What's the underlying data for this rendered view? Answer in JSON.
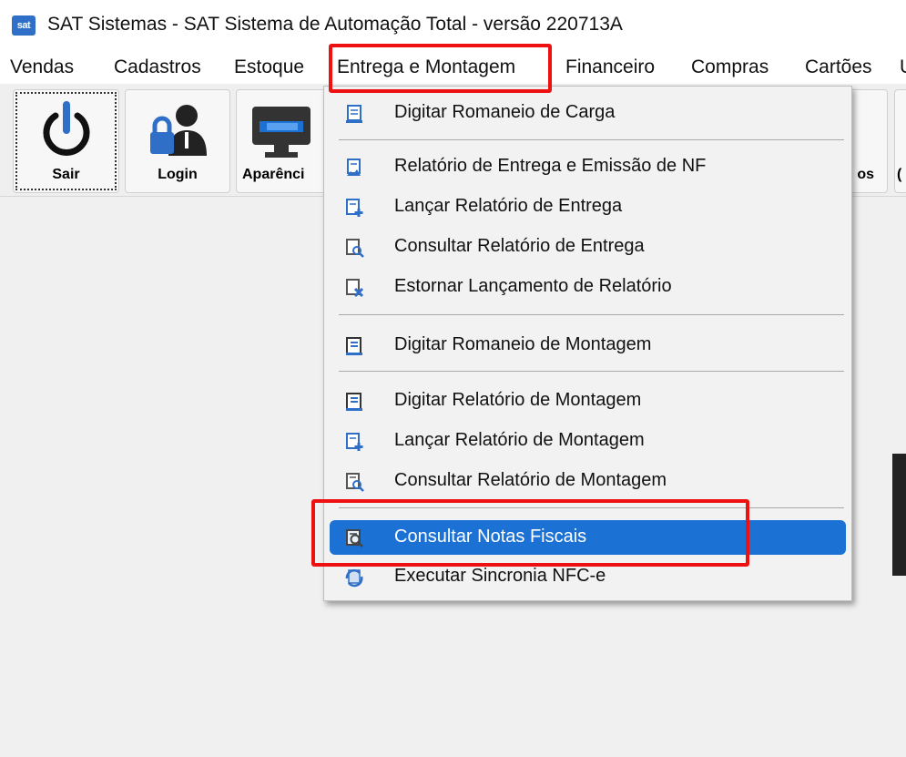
{
  "window": {
    "title": "SAT Sistemas - SAT Sistema de Automação Total - versão 220713A",
    "logo_text": "sat"
  },
  "menubar": {
    "items": [
      {
        "label": "Vendas"
      },
      {
        "label": "Cadastros"
      },
      {
        "label": "Estoque"
      },
      {
        "label": "Entrega e Montagem"
      },
      {
        "label": "Financeiro"
      },
      {
        "label": "Compras"
      },
      {
        "label": "Cartões"
      },
      {
        "label": "U"
      }
    ]
  },
  "toolbar": {
    "buttons": [
      {
        "label": "Sair",
        "icon": "power-icon"
      },
      {
        "label": "Login",
        "icon": "user-lock-icon"
      },
      {
        "label": "Aparênci",
        "icon": "monitor-icon"
      },
      {
        "label": "os",
        "icon": "document-icon"
      },
      {
        "label": "(",
        "icon": "partial-icon"
      }
    ]
  },
  "dropdown": {
    "items": [
      {
        "label": "Digitar Romaneio de Carga",
        "icon": "form-icon"
      },
      {
        "label": "Relatório de Entrega e Emissão de NF",
        "icon": "report-invoice-icon"
      },
      {
        "label": "Lançar Relatório de Entrega",
        "icon": "report-add-icon"
      },
      {
        "label": "Consultar Relatório de Entrega",
        "icon": "report-search-icon"
      },
      {
        "label": "Estornar Lançamento de Relatório",
        "icon": "report-remove-icon"
      },
      {
        "label": "Digitar Romaneio de Montagem",
        "icon": "assembly-form-icon"
      },
      {
        "label": "Digitar Relatório de Montagem",
        "icon": "assembly-report-icon"
      },
      {
        "label": "Lançar Relatório de Montagem",
        "icon": "assembly-add-icon"
      },
      {
        "label": "Consultar Relatório de Montagem",
        "icon": "assembly-search-icon"
      },
      {
        "label": "Consultar Notas Fiscais",
        "icon": "invoice-search-icon"
      },
      {
        "label": "Executar Sincronia NFC-e",
        "icon": "sync-icon"
      }
    ]
  },
  "colors": {
    "selection": "#1c72d4",
    "highlight": "#ee1111",
    "icon_blue": "#2f6fc7"
  }
}
